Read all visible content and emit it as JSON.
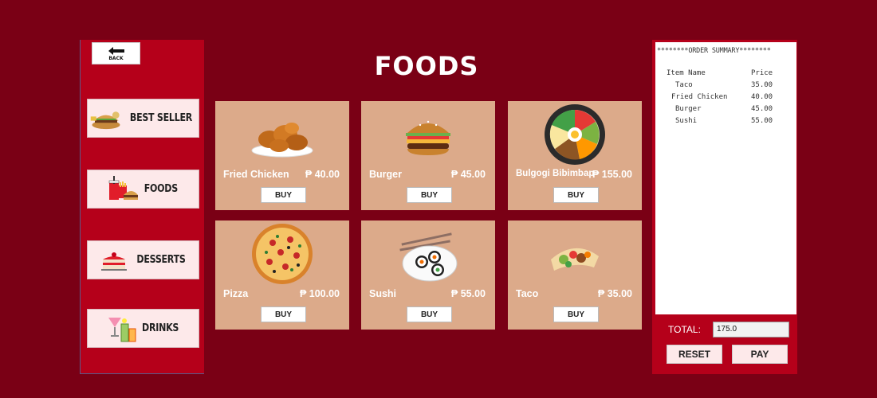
{
  "back": {
    "label": "BACK"
  },
  "sidebar": {
    "items": [
      {
        "label": "BEST SELLER",
        "icon": "burger-basket-icon"
      },
      {
        "label": "FOODS",
        "icon": "fastfood-icon"
      },
      {
        "label": "DESSERTS",
        "icon": "cake-icon"
      },
      {
        "label": "DRINKS",
        "icon": "cocktail-icon"
      }
    ]
  },
  "page": {
    "title": "FOODS"
  },
  "products": [
    {
      "name": "Fried Chicken",
      "price": "₱ 40.00",
      "buy": "BUY",
      "image": "fried-chicken-image"
    },
    {
      "name": "Burger",
      "price": "₱ 45.00",
      "buy": "BUY",
      "image": "burger-image"
    },
    {
      "name": "Bulgogi Bibimbap",
      "price": "₱ 155.00",
      "buy": "BUY",
      "image": "bibimbap-image"
    },
    {
      "name": "Pizza",
      "price": "₱ 100.00",
      "buy": "BUY",
      "image": "pizza-image"
    },
    {
      "name": "Sushi",
      "price": "₱ 55.00",
      "buy": "BUY",
      "image": "sushi-image"
    },
    {
      "name": "Taco",
      "price": "₱ 35.00",
      "buy": "BUY",
      "image": "taco-image"
    }
  ],
  "order": {
    "header": "********ORDER SUMMARY********",
    "col_item": "Item Name",
    "col_price": "Price",
    "items": [
      {
        "name": "Taco",
        "price": "35.00"
      },
      {
        "name": "Fried Chicken",
        "price": "40.00"
      },
      {
        "name": "Burger",
        "price": "45.00"
      },
      {
        "name": "Sushi",
        "price": "55.00"
      }
    ],
    "total_label": "TOTAL:",
    "total_value": "175.0",
    "reset_label": "RESET",
    "pay_label": "PAY"
  },
  "colors": {
    "background": "#7a0015",
    "panel": "#b5001a",
    "card": "#dcaa8a",
    "button": "#fde9ea"
  }
}
